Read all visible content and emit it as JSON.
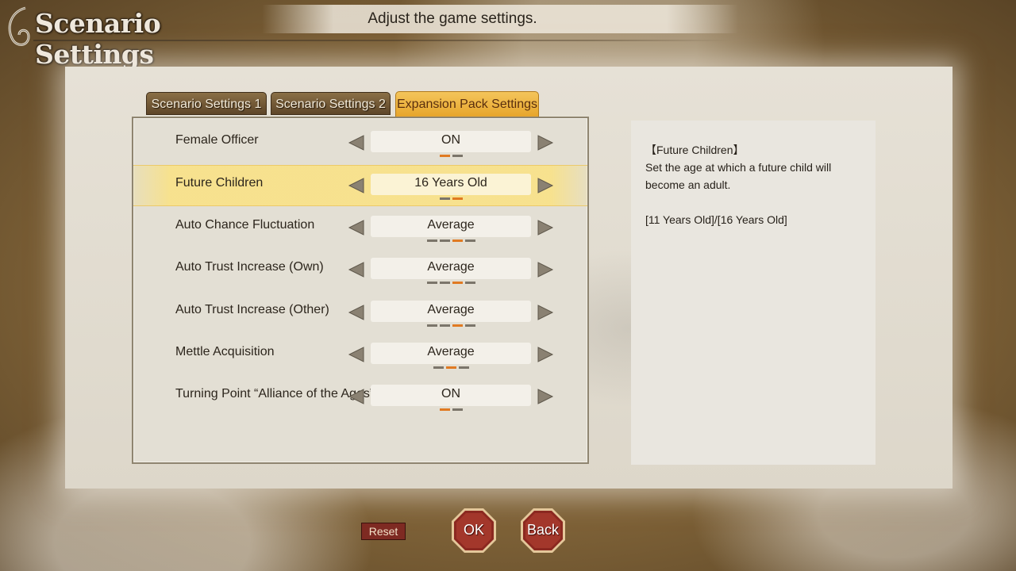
{
  "header": {
    "title": "Scenario Settings",
    "subtitle": "Adjust the game settings."
  },
  "tabs": [
    {
      "label": "Scenario Settings 1",
      "active": false
    },
    {
      "label": "Scenario Settings 2",
      "active": false
    },
    {
      "label": "Expansion Pack Settings",
      "active": true
    }
  ],
  "settings": [
    {
      "label": "Female Officer",
      "value": "ON",
      "level": 1,
      "levels": 2,
      "selected": false
    },
    {
      "label": "Future Children",
      "value": "16 Years Old",
      "level": 2,
      "levels": 2,
      "selected": true
    },
    {
      "label": "Auto Chance Fluctuation",
      "value": "Average",
      "level": 3,
      "levels": 4,
      "selected": false
    },
    {
      "label": "Auto Trust Increase (Own)",
      "value": "Average",
      "level": 3,
      "levels": 4,
      "selected": false
    },
    {
      "label": "Auto Trust Increase (Other)",
      "value": "Average",
      "level": 3,
      "levels": 4,
      "selected": false
    },
    {
      "label": "Mettle Acquisition",
      "value": "Average",
      "level": 2,
      "levels": 3,
      "selected": false
    },
    {
      "label": "Turning Point “Alliance of the Ages”",
      "value": "ON",
      "level": 1,
      "levels": 2,
      "selected": false
    }
  ],
  "info": {
    "title": "【Future Children】",
    "description": "Set the age at which a future child will become an adult.",
    "options": "[11 Years Old]/[16 Years Old]"
  },
  "buttons": {
    "reset": "Reset",
    "ok": "OK",
    "back": "Back"
  },
  "colors": {
    "accent": "#e07a22",
    "active_tab": "#f0b642",
    "button_red": "#8e2a22"
  }
}
